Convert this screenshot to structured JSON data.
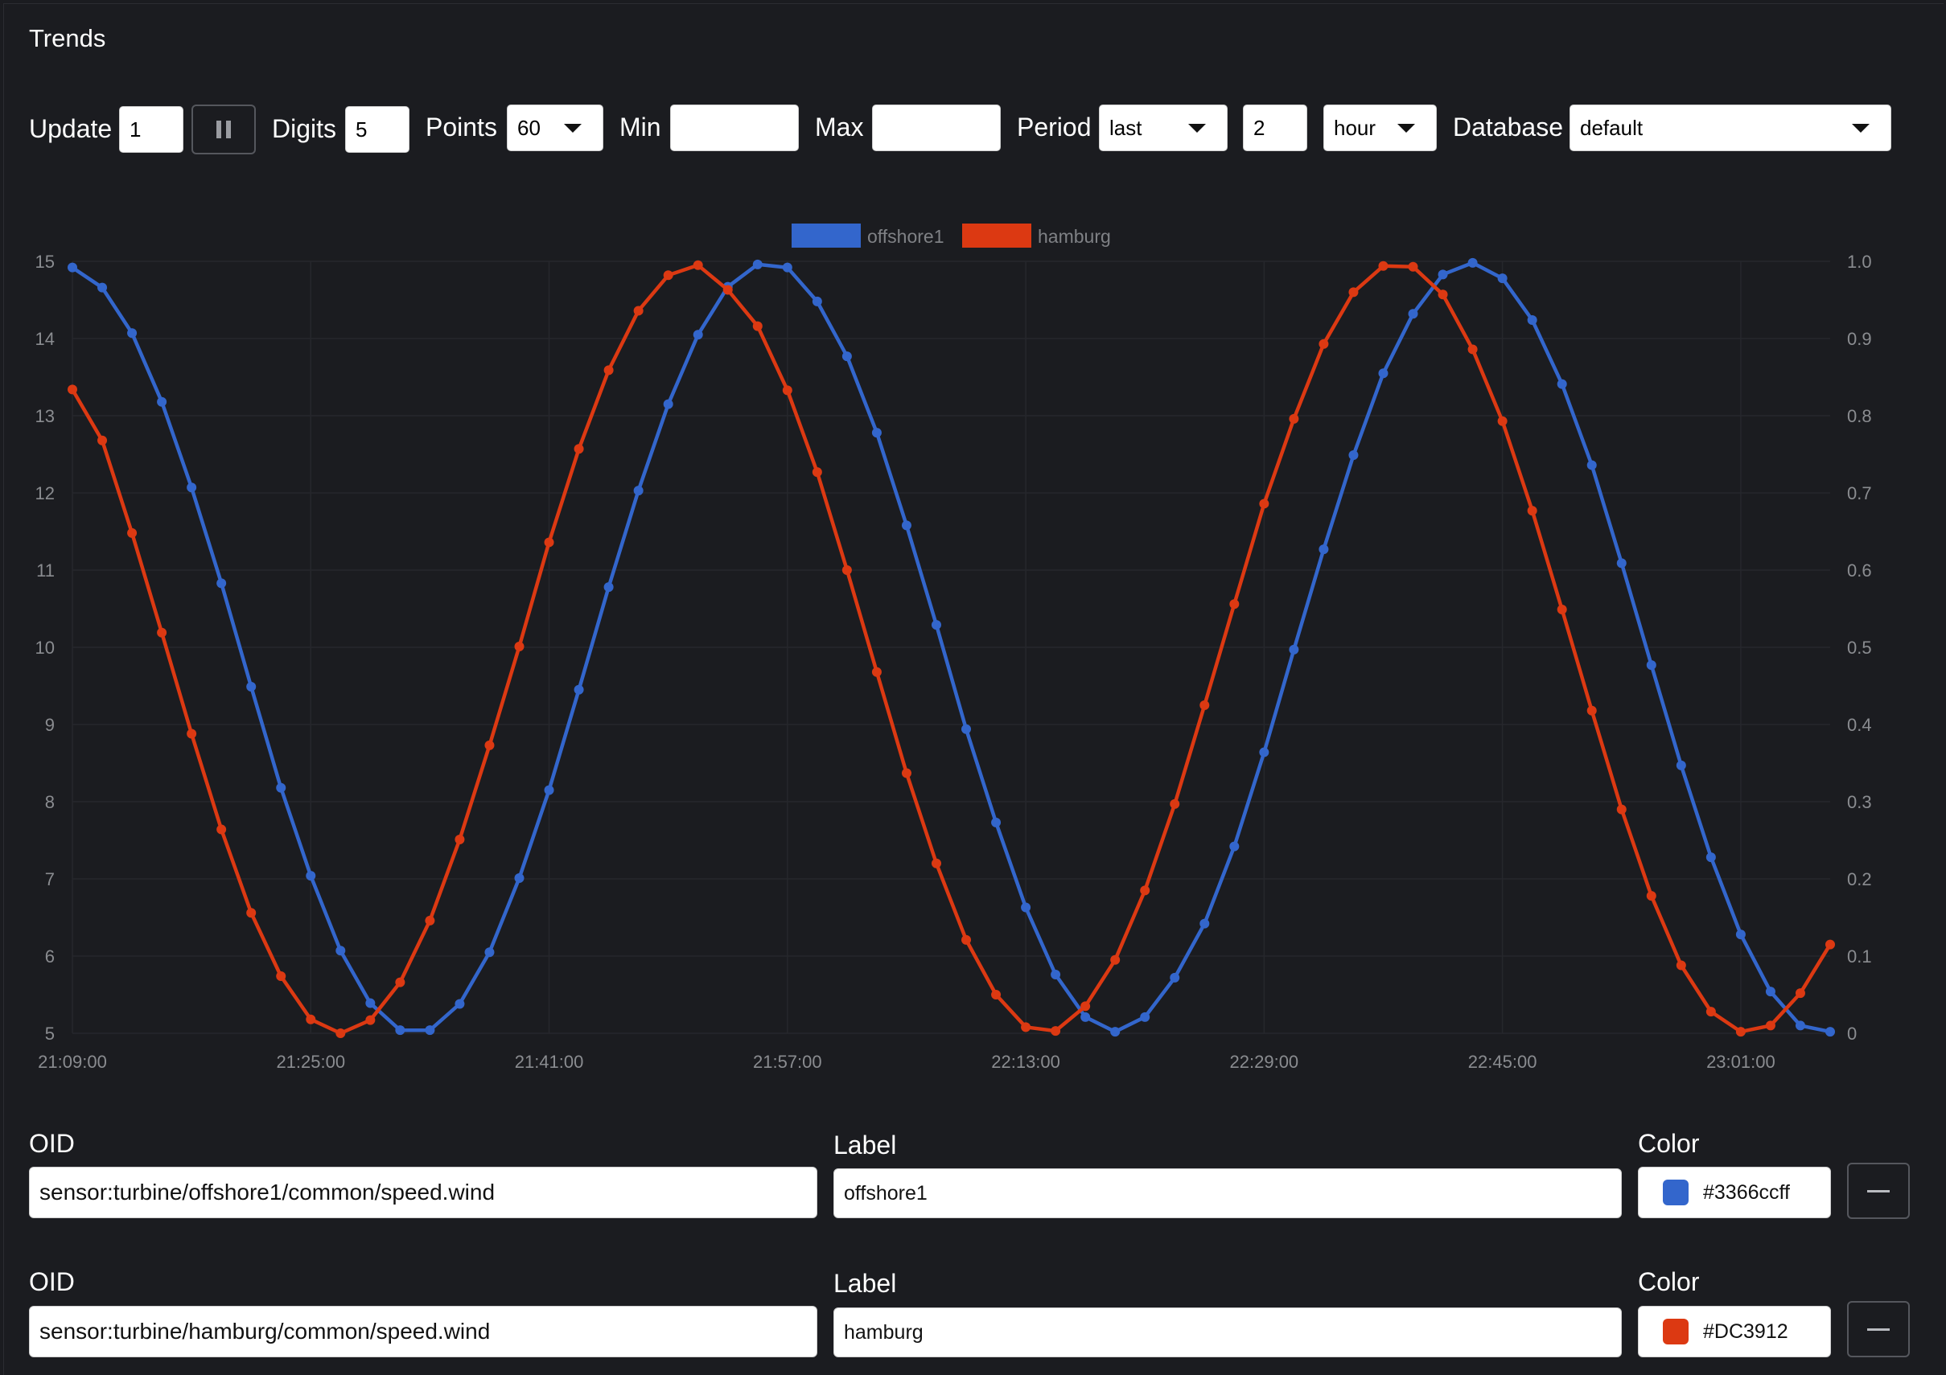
{
  "window": {
    "title": "Trends"
  },
  "toolbar": {
    "update_label": "Update",
    "update_value": "1",
    "digits_label": "Digits",
    "digits_value": "5",
    "points_label": "Points",
    "points_value": "60",
    "min_label": "Min",
    "min_value": "",
    "max_label": "Max",
    "max_value": "",
    "period_label": "Period",
    "period_mode": "last",
    "period_count": "2",
    "period_unit": "hour",
    "database_label": "Database",
    "database_value": "default"
  },
  "rows": [
    {
      "oid_label": "OID",
      "oid": "sensor:turbine/offshore1/common/speed.wind",
      "label_label": "Label",
      "label": "offshore1",
      "color_label": "Color",
      "color_text": "#3366ccff",
      "color": "#3366cc"
    },
    {
      "oid_label": "OID",
      "oid": "sensor:turbine/hamburg/common/speed.wind",
      "label_label": "Label",
      "label": "hamburg",
      "color_label": "Color",
      "color_text": "#DC3912",
      "color": "#dc3912"
    }
  ],
  "chart_data": {
    "type": "line",
    "legend": "top-center",
    "grid": true,
    "x_ticks": [
      "21:09:00",
      "21:25:00",
      "21:41:00",
      "21:57:00",
      "22:13:00",
      "22:29:00",
      "22:45:00",
      "23:01:00"
    ],
    "y_left_ticks": [
      "5",
      "6",
      "7",
      "8",
      "9",
      "10",
      "11",
      "12",
      "13",
      "14",
      "15"
    ],
    "y_right_ticks": [
      "0",
      "0.1",
      "0.2",
      "0.3",
      "0.4",
      "0.5",
      "0.6",
      "0.7",
      "0.8",
      "0.9",
      "1.0"
    ],
    "ylim_left": [
      5,
      15
    ],
    "ylim_right": [
      0,
      1
    ],
    "x_start_minutes": 0,
    "x_step_minutes": 2,
    "series": [
      {
        "name": "offshore1",
        "color": "#3366cc",
        "axis": "left",
        "values": [
          14.92,
          14.66,
          14.07,
          13.18,
          12.07,
          10.83,
          9.49,
          8.18,
          7.04,
          6.07,
          5.39,
          5.04,
          5.04,
          5.38,
          6.05,
          7.01,
          8.15,
          9.45,
          10.78,
          12.03,
          13.15,
          14.05,
          14.67,
          14.96,
          14.92,
          14.48,
          13.77,
          12.78,
          11.58,
          10.29,
          8.94,
          7.73,
          6.63,
          5.76,
          5.21,
          5.02,
          5.21,
          5.72,
          6.42,
          7.42,
          8.64,
          9.97,
          11.27,
          12.49,
          13.55,
          14.32,
          14.83,
          14.98,
          14.78,
          14.24,
          13.41,
          12.36,
          11.09,
          9.77,
          8.47,
          7.28,
          6.28,
          5.54,
          5.1,
          5.02
        ]
      },
      {
        "name": "hamburg",
        "color": "#dc3912",
        "axis": "right",
        "values": [
          0.834,
          0.768,
          0.648,
          0.519,
          0.388,
          0.264,
          0.156,
          0.074,
          0.018,
          0.0,
          0.017,
          0.066,
          0.146,
          0.251,
          0.373,
          0.501,
          0.636,
          0.757,
          0.859,
          0.936,
          0.982,
          0.995,
          0.963,
          0.916,
          0.833,
          0.727,
          0.6,
          0.468,
          0.337,
          0.22,
          0.121,
          0.05,
          0.008,
          0.003,
          0.035,
          0.095,
          0.185,
          0.297,
          0.425,
          0.556,
          0.686,
          0.796,
          0.893,
          0.96,
          0.994,
          0.993,
          0.957,
          0.886,
          0.793,
          0.677,
          0.549,
          0.418,
          0.29,
          0.178,
          0.088,
          0.028,
          0.002,
          0.01,
          0.052,
          0.115
        ]
      }
    ]
  }
}
